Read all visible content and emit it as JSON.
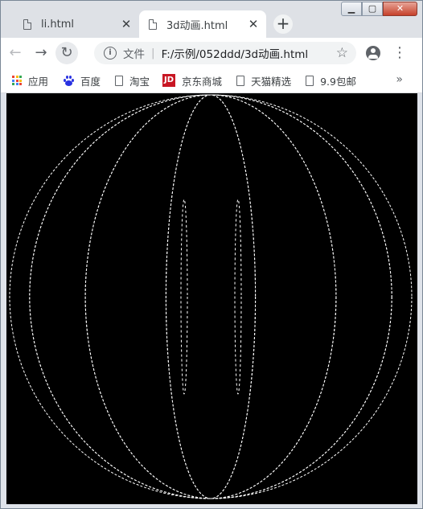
{
  "window": {
    "controls": {
      "minimize": "▁",
      "maximize": "▢",
      "close": "✕"
    }
  },
  "tabs": [
    {
      "title": "li.html",
      "active": false,
      "icon": "page-icon"
    },
    {
      "title": "3d动画.html",
      "active": true,
      "icon": "page-icon"
    }
  ],
  "tab_close_glyph": "✕",
  "new_tab_glyph": "+",
  "toolbar": {
    "back": "←",
    "forward": "→",
    "reload": "↻",
    "scheme_label": "文件",
    "url": "F:/示例/052ddd/3d动画.html",
    "info_glyph": "i",
    "star_glyph": "☆",
    "menu_glyph": "⋮"
  },
  "bookmarks": {
    "items": [
      {
        "label": "应用",
        "icon": "apps-icon"
      },
      {
        "label": "百度",
        "icon": "baidu-icon"
      },
      {
        "label": "淘宝",
        "icon": "page-icon"
      },
      {
        "label": "京东商城",
        "icon": "jd-icon",
        "icon_text": "JD"
      },
      {
        "label": "天猫精选",
        "icon": "page-icon"
      },
      {
        "label": "9.9包邮",
        "icon": "page-icon"
      }
    ],
    "more_glyph": "»"
  },
  "content": {
    "background": "#000000",
    "stroke_color": "#ffffff",
    "meridian_count": 7
  },
  "colors": {
    "tabstrip_bg": "#dee1e6",
    "omnibox_bg": "#f1f3f4",
    "apps_icon": [
      "#ea4335",
      "#fbbc05",
      "#34a853",
      "#4285f4",
      "#ea4335",
      "#fbbc05",
      "#34a853",
      "#4285f4",
      "#ea4335"
    ]
  }
}
